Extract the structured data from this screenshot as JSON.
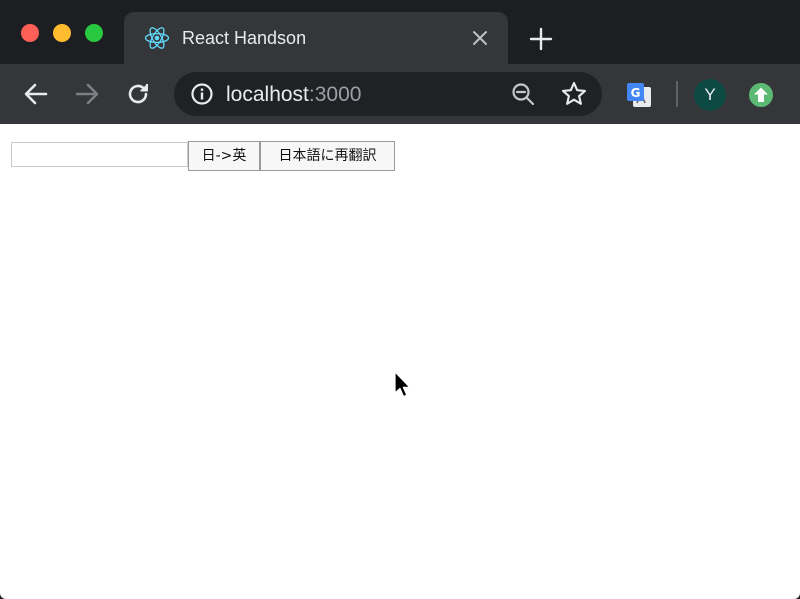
{
  "browser": {
    "tab": {
      "title": "React Handson",
      "favicon": "react-logo-icon"
    },
    "address_bar": {
      "host": "localhost",
      "port": ":3000"
    },
    "profile": {
      "initial": "Y"
    },
    "colors": {
      "frame": "#1d1e21",
      "toolbar": "#35363a",
      "omnibox": "#202124",
      "react_accent": "#61dafb",
      "avatar_bg": "#0d4a44",
      "update_badge": "#5bb974"
    },
    "icons": [
      "back-icon",
      "forward-icon",
      "reload-icon",
      "info-icon",
      "zoom-out-icon",
      "star-icon",
      "google-translate-icon",
      "update-icon",
      "close-icon",
      "plus-icon"
    ]
  },
  "page": {
    "input": {
      "value": "",
      "placeholder": ""
    },
    "buttons": {
      "translate_label": "日->英",
      "retranslate_label": "日本語に再翻訳"
    }
  }
}
